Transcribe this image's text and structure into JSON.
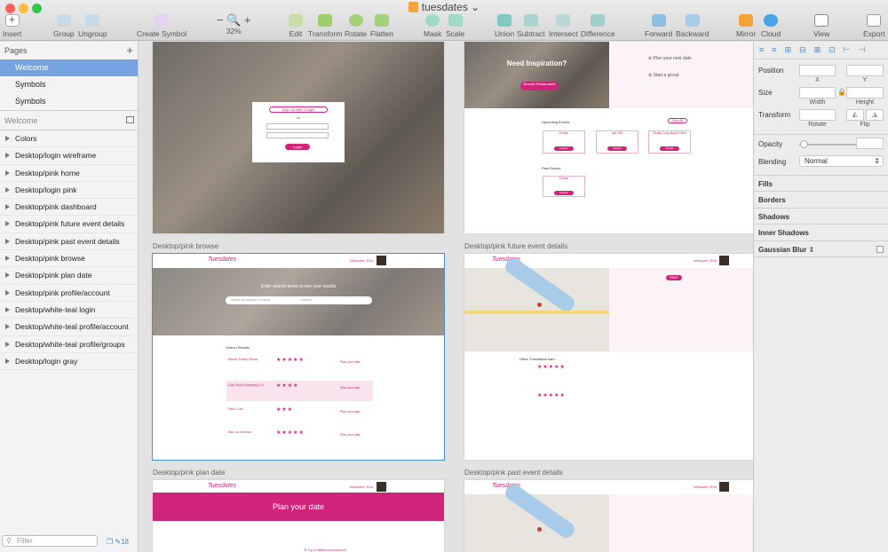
{
  "window": {
    "title": "tuesdates"
  },
  "toolbar": {
    "insert": "Insert",
    "group": "Group",
    "ungroup": "Ungroup",
    "create_symbol": "Create Symbol",
    "zoom": "32%",
    "edit": "Edit",
    "transform": "Transform",
    "rotate": "Rotate",
    "flatten": "Flatten",
    "mask": "Mask",
    "scale": "Scale",
    "union": "Union",
    "subtract": "Subtract",
    "intersect": "Intersect",
    "difference": "Difference",
    "forward": "Forward",
    "backward": "Backward",
    "mirror": "Mirror",
    "cloud": "Cloud",
    "view": "View",
    "export": "Export"
  },
  "sidebar": {
    "pages_header": "Pages",
    "pages": [
      "Welcome",
      "Symbols",
      "Symbols"
    ],
    "layers_header": "Welcome",
    "layers": [
      "Colors",
      "Desktop/login wireframe",
      "Desktop/pink home",
      "Desktop/login pink",
      "Desktop/pink dashboard",
      "Desktop/pink future event details",
      "Desktop/pink past event details",
      "Desktop/pink browse",
      "Desktop/pink plan date",
      "Desktop/pink profile/account",
      "Desktop/white-teal login",
      "Desktop/white-teal profile/account",
      "Desktop/white-teal profile/groups",
      "Desktop/login gray"
    ],
    "filter_placeholder": "Filter",
    "count": "18"
  },
  "canvas": {
    "labels": {
      "browse": "Desktop/pink browse",
      "future": "Desktop/pink future event details",
      "plan": "Desktop/pink plan date",
      "past": "Desktop/pink past event details"
    },
    "login": {
      "signup": "Sign Up with Google",
      "or": "or",
      "login": "Login"
    },
    "dashboard": {
      "inspiration": "Need Inspiration?",
      "browse_btn": "Browse Restaurants",
      "plan_next": "Plan your next date",
      "start_group": "Start a group",
      "upcoming": "Upcoming Events",
      "view_all": "View All",
      "past": "Past Events",
      "events": [
        "Evolve",
        "Apt 108",
        "Really Long Name Here"
      ],
      "past_event": "Evolve",
      "details": "Details"
    },
    "brand": "Tuesdates",
    "welcome": "Welcome, Erin",
    "browse": {
      "hero": "Enter search terms to see your results",
      "search_ph": "Search by location or cuisine",
      "select_ph": "Cuisine",
      "results": "Search Results",
      "rows": [
        "Black Sheep Pizza",
        "Day Block Brewing Co.",
        "Red Cow",
        "Bar La Grassa"
      ],
      "plan": "Plan your date"
    },
    "future": {
      "rsvp": "RSVP",
      "other": "Other Tuesdaters said..."
    },
    "plan": {
      "hero": "Plan your date",
      "alt": "Try a different restaurant"
    }
  },
  "inspector": {
    "position": "Position",
    "x": "X",
    "y": "Y",
    "size": "Size",
    "width": "Width",
    "height": "Height",
    "transform": "Transform",
    "rotate": "Rotate",
    "flip": "Flip",
    "opacity": "Opacity",
    "blending": "Blending",
    "blend_value": "Normal",
    "sections": [
      "Fills",
      "Borders",
      "Shadows",
      "Inner Shadows",
      "Gaussian Blur"
    ]
  }
}
